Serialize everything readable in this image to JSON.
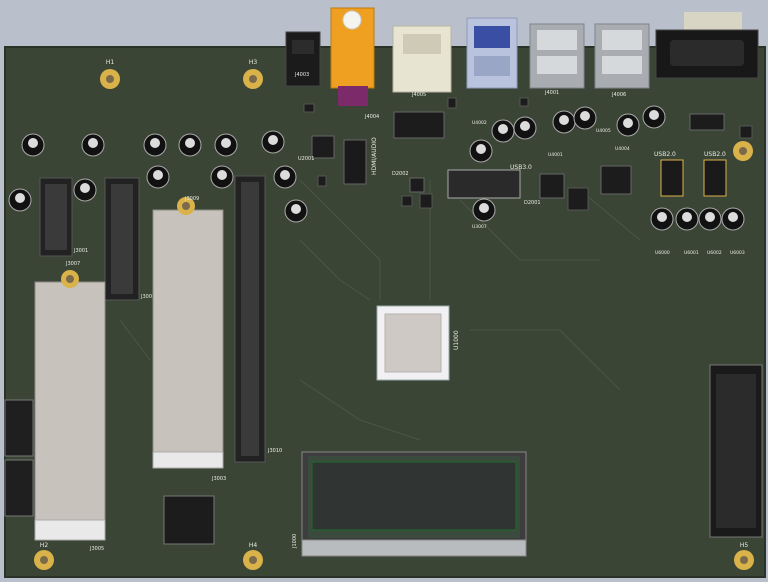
{
  "board": {
    "pcb_color": "#3b4536",
    "background_color": "#b9c0cc",
    "silkscreen_color": "#e8ece4",
    "mounting_hole_labels": {
      "top_left": "H1",
      "top_middle": "H3",
      "bottom_left": "H2",
      "bottom_middle": "H4",
      "bottom_right": "H5"
    },
    "ports_labels": {
      "hdmi_audio": "HDMI/AUDIO",
      "usb3": "USB3.0",
      "usb2_left": "USB2.0",
      "usb2_right": "USB2.0"
    },
    "designators": {
      "j4003": "J4003",
      "j4004": "J4004",
      "j4005": "J4005",
      "j4001": "J4001",
      "j4006": "J4006",
      "u2001": "U2001",
      "d2002": "D2002",
      "d2001": "D2001",
      "u1000": "U1000",
      "u1001": "U1001",
      "j3001": "J3001",
      "j3002": "J3002",
      "j3003": "J3003",
      "j3005": "J3005",
      "j3007": "J3007",
      "j3009": "J3009",
      "j3010": "J3010",
      "j3008": "J3008",
      "j1000": "J1000",
      "u6000": "U6000",
      "u6001": "U6001",
      "u6002": "U6002",
      "u6003": "U6003",
      "u3007": "U3007",
      "u4001": "U4001",
      "u4002": "U4002",
      "u4005": "U4005",
      "u4004": "U4004"
    }
  }
}
